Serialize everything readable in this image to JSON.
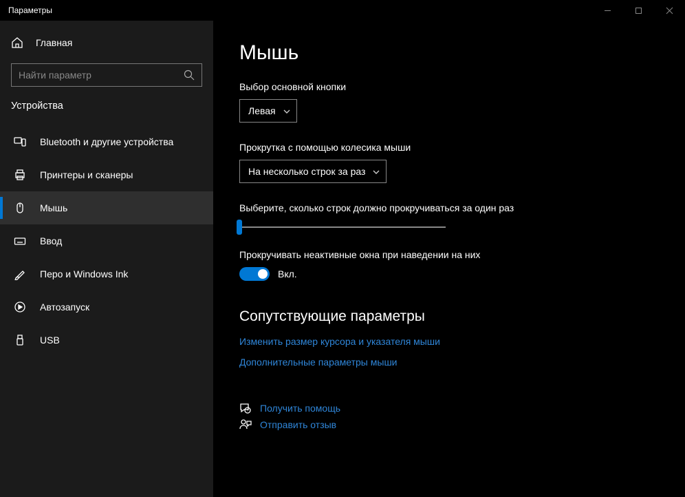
{
  "window": {
    "title": "Параметры"
  },
  "sidebar": {
    "home": "Главная",
    "search_placeholder": "Найти параметр",
    "category": "Устройства",
    "items": [
      {
        "label": "Bluetooth и другие устройства"
      },
      {
        "label": "Принтеры и сканеры"
      },
      {
        "label": "Мышь"
      },
      {
        "label": "Ввод"
      },
      {
        "label": "Перо и Windows Ink"
      },
      {
        "label": "Автозапуск"
      },
      {
        "label": "USB"
      }
    ]
  },
  "main": {
    "title": "Мышь",
    "primary_button_label": "Выбор основной кнопки",
    "primary_button_value": "Левая",
    "scroll_mode_label": "Прокрутка с помощью колесика мыши",
    "scroll_mode_value": "На несколько строк за раз",
    "lines_label": "Выберите, сколько строк должно прокручиваться за один раз",
    "inactive_label": "Прокручивать неактивные окна при наведении на них",
    "toggle_state": "Вкл.",
    "related_heading": "Сопутствующие параметры",
    "link1": "Изменить размер курсора и указателя мыши",
    "link2": "Дополнительные параметры мыши",
    "help": "Получить помощь",
    "feedback": "Отправить отзыв"
  }
}
